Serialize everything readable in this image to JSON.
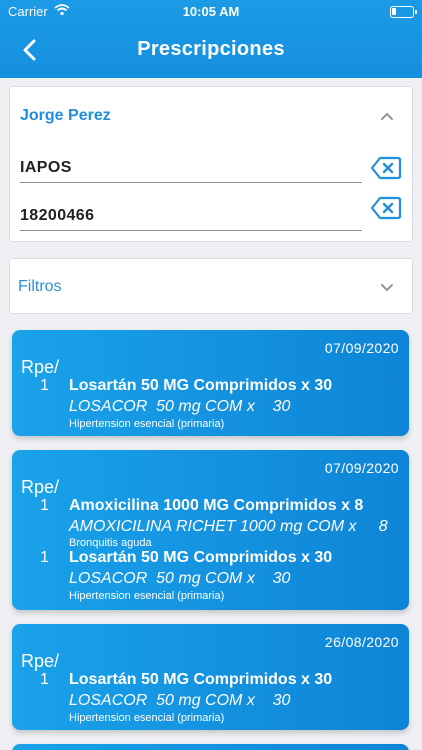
{
  "status_bar": {
    "carrier": "Carrier",
    "time": "10:05 AM"
  },
  "header": {
    "title": "Prescripciones"
  },
  "patient": {
    "name": "Jorge Perez",
    "insurer_value": "IAPOS",
    "affiliate_value": "18200466"
  },
  "filters": {
    "label": "Filtros"
  },
  "prescriptions": [
    {
      "date": "07/09/2020",
      "rpe": "Rpe/",
      "items": [
        {
          "qty": "1",
          "name": "Losartán 50 MG Comprimidos x 30",
          "brand": "LOSACOR  50 mg COM x    30",
          "diagnosis": "Hipertension esencial (primaria)"
        }
      ]
    },
    {
      "date": "07/09/2020",
      "rpe": "Rpe/",
      "items": [
        {
          "qty": "1",
          "name": "Amoxicilina 1000 MG Comprimidos x 8",
          "brand": "AMOXICILINA RICHET 1000 mg COM x     8",
          "diagnosis": "Bronquitis aguda"
        },
        {
          "qty": "1",
          "name": "Losartán 50 MG Comprimidos x 30",
          "brand": "LOSACOR  50 mg COM x    30",
          "diagnosis": "Hipertension esencial (primaria)"
        }
      ]
    },
    {
      "date": "26/08/2020",
      "rpe": "Rpe/",
      "items": [
        {
          "qty": "1",
          "name": "Losartán 50 MG Comprimidos x 30",
          "brand": "LOSACOR  50 mg COM x    30",
          "diagnosis": "Hipertension esencial (primaria)"
        }
      ]
    }
  ]
}
